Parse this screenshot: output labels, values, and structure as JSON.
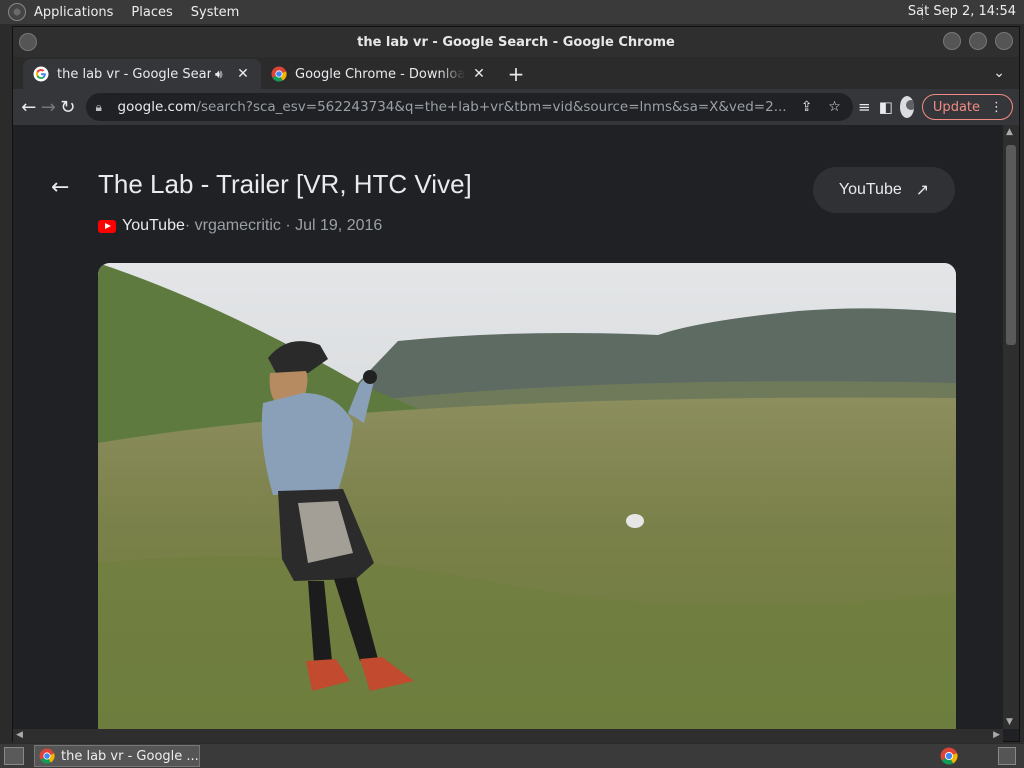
{
  "topbar": {
    "menus": [
      "Applications",
      "Places",
      "System"
    ],
    "clock": "Sat Sep  2, 14:54"
  },
  "window": {
    "title": "the lab vr - Google Search - Google Chrome"
  },
  "tabs": [
    {
      "label": "the lab vr - Google Search",
      "active": true,
      "audio": true
    },
    {
      "label": "Google Chrome - Download th",
      "active": false,
      "audio": false
    }
  ],
  "toolbar": {
    "url_host": "google.com",
    "url_path": "/search?sca_esv=562243734&q=the+lab+vr&tbm=vid&source=lnms&sa=X&ved=2...",
    "update_label": "Update"
  },
  "video": {
    "title": "The Lab - Trailer [VR, HTC Vive]",
    "source": "YouTube",
    "meta_rest": " · vrgamecritic · Jul 19, 2016",
    "open_button": "YouTube"
  },
  "taskbar": {
    "task_label": "the lab vr - Google ..."
  },
  "colors": {
    "accent_update": "#f28b82",
    "youtube_red": "#ff0000",
    "page_bg": "#202124"
  }
}
